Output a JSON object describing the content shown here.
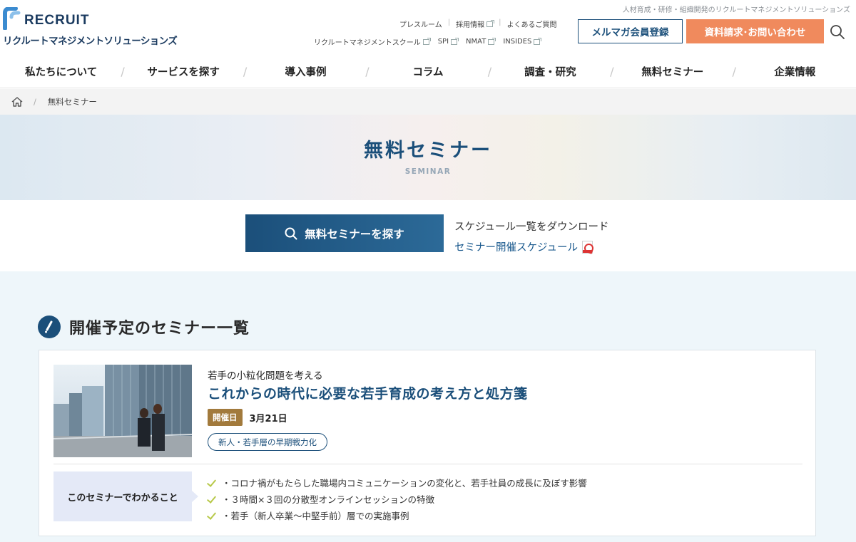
{
  "header": {
    "logo_word": "RECRUIT",
    "logo_sub": "リクルートマネジメントソリューションズ",
    "tagline": "人材育成・研修・組織開発のリクルートマネジメントソリューションズ",
    "util_links_row1": [
      "プレスルーム",
      "採用情報",
      "よくあるご質問"
    ],
    "util_links_row2": [
      "リクルートマネジメントスクール",
      "SPI",
      "NMAT",
      "INSIDES"
    ],
    "mail_button": "メルマガ会員登録",
    "contact_button": "資料請求･お問い合わせ"
  },
  "nav": [
    "私たちについて",
    "サービスを探す",
    "導入事例",
    "コラム",
    "調査・研究",
    "無料セミナー",
    "企業情報"
  ],
  "breadcrumb": {
    "current": "無料セミナー"
  },
  "hero": {
    "title": "無料セミナー",
    "subtitle": "SEMINAR"
  },
  "search": {
    "button": "無料セミナーを探す",
    "download_label": "スケジュール一覧をダウンロード",
    "schedule_link": "セミナー開催スケジュール"
  },
  "section": {
    "title": "開催予定のセミナー一覧",
    "card": {
      "lead": "若手の小粒化問題を考える",
      "title": "これからの時代に必要な若手育成の考え方と処方箋",
      "date_label": "開催日",
      "date": "3月21日",
      "tag": "新人・若手層の早期戦力化",
      "learn_label": "このセミナーでわかること",
      "points": [
        "・コロナ禍がもたらした職場内コミュニケーションの変化と、若手社員の成長に及ぼす影響",
        "・３時間×３回の分散型オンラインセッションの特徴",
        "・若手（新人卒業～中堅手前）層での実施事例"
      ]
    }
  },
  "colors": {
    "brand": "#1b4f7a",
    "accent": "#f08a5d",
    "badge": "#a27a3c",
    "check": "#b8c94a"
  }
}
